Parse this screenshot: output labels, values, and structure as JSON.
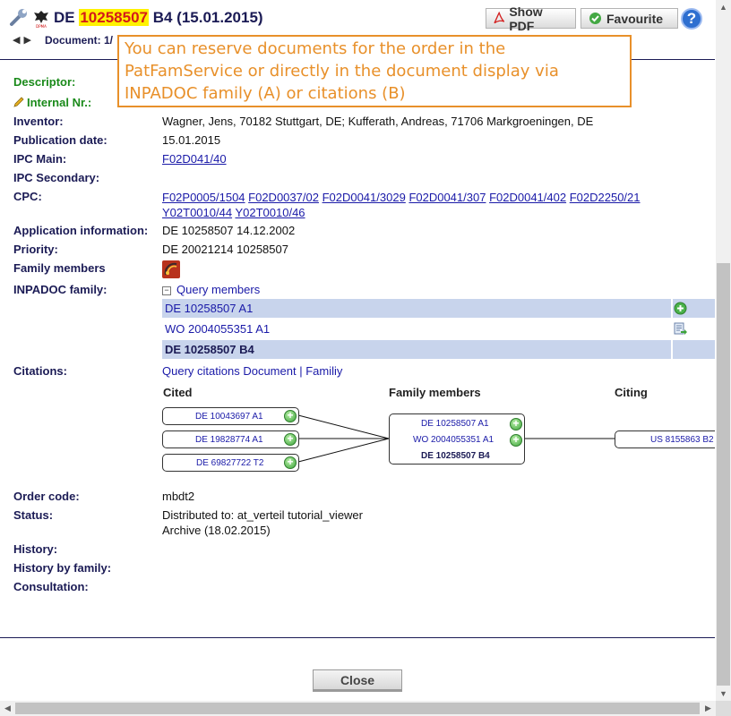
{
  "header": {
    "doc_prefix": "DE ",
    "doc_number": "10258507",
    "doc_suffix": " B4 (15.01.2015)",
    "eagle_caption": "DPMA",
    "show_pdf_label": "Show PDF",
    "favourite_label": "Favourite",
    "help_label": "?",
    "document_label": "Document: 1/"
  },
  "callout": {
    "text": "You can reserve documents for the order in the PatFamService or directly in the document display via INPADOC family (A) or citations (B)",
    "color": "#e8902a"
  },
  "fields": {
    "descriptor_label": "Descriptor:",
    "internal_label": "Internal Nr.:",
    "inventor_label": "Inventor:",
    "inventor_value": "Wagner, Jens, 70182 Stuttgart, DE; Kufferath, Andreas, 71706 Markgroeningen, DE",
    "pubdate_label": "Publication date:",
    "pubdate_value": "15.01.2015",
    "ipc_main_label": "IPC Main:",
    "ipc_main_value": "F02D041/40",
    "ipc_secondary_label": "IPC Secondary:",
    "cpc_label": "CPC:",
    "cpc_codes": [
      "F02P0005/1504",
      "F02D0037/02",
      "F02D0041/3029",
      "F02D0041/307",
      "F02D0041/402",
      "F02D2250/21",
      "Y02T0010/44",
      "Y02T0010/46"
    ],
    "appinfo_label": "Application information:",
    "appinfo_value": "DE 10258507 14.12.2002",
    "priority_label": "Priority:",
    "priority_value": "DE 20021214 10258507",
    "family_members_label": "Family members",
    "inpadoc_label": "INPADOC family:",
    "query_members_label": "Query members",
    "citations_label": "Citations:",
    "order_code_label": "Order code:",
    "order_code_value": "mbdt2",
    "status_label": "Status:",
    "status_line1": "Distributed to: at_verteil tutorial_viewer",
    "status_line2": "Archive (18.02.2015)",
    "history_label": "History:",
    "history_family_label": "History by family:",
    "consultation_label": "Consultation:"
  },
  "inpadoc": {
    "rows": [
      {
        "doc": "DE 10258507 A1",
        "action": "add-icon"
      },
      {
        "doc": "WO 2004055351 A1",
        "action": "reserve-icon"
      },
      {
        "doc": "DE 10258507 B4",
        "action": ""
      }
    ]
  },
  "citations": {
    "query_citations_label": "Query citations",
    "document_link": "Document",
    "separator": "|",
    "family_link": "Familiy",
    "cited_header": "Cited",
    "family_header": "Family members",
    "citing_header": "Citing",
    "cited": [
      "DE 10043697 A1",
      "DE 19828774 A1",
      "DE 69827722 T2"
    ],
    "family": [
      "DE 10258507 A1",
      "WO 2004055351 A1",
      "DE 10258507 B4"
    ],
    "citing": [
      "US 8155863 B2"
    ]
  },
  "footer": {
    "close_label": "Close"
  },
  "colors": {
    "header_text": "#1b1b55",
    "highlight_bg": "#fff200",
    "highlight_text": "#d41a1a",
    "descriptor_green": "#1a8a1a",
    "row_shade": "#c8d4ec",
    "link": "#1a1aa8"
  }
}
